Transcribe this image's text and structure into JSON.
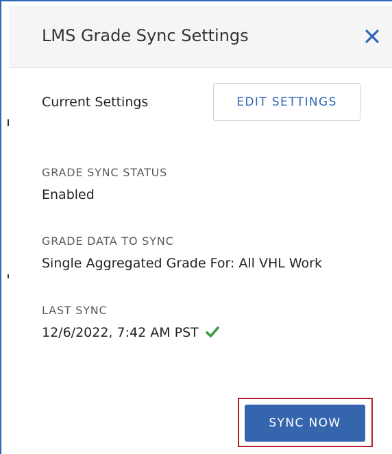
{
  "dialog": {
    "title": "LMS Grade Sync Settings",
    "close_icon": "close-icon"
  },
  "current_settings": {
    "label": "Current Settings",
    "edit_button_label": "EDIT SETTINGS"
  },
  "grade_sync_status": {
    "label": "GRADE SYNC STATUS",
    "value": "Enabled"
  },
  "grade_data_to_sync": {
    "label": "GRADE DATA TO SYNC",
    "value": "Single Aggregated Grade For: All VHL Work"
  },
  "last_sync": {
    "label": "LAST SYNC",
    "value": "12/6/2022, 7:42 AM PST",
    "status_icon": "checkmark-icon"
  },
  "actions": {
    "sync_now_label": "SYNC NOW"
  },
  "colors": {
    "accent": "#2e67b5",
    "button_primary": "#3565ad",
    "highlight_border": "#b81f2b",
    "success": "#3a9a3f",
    "header_bg": "#f5f5f5"
  }
}
